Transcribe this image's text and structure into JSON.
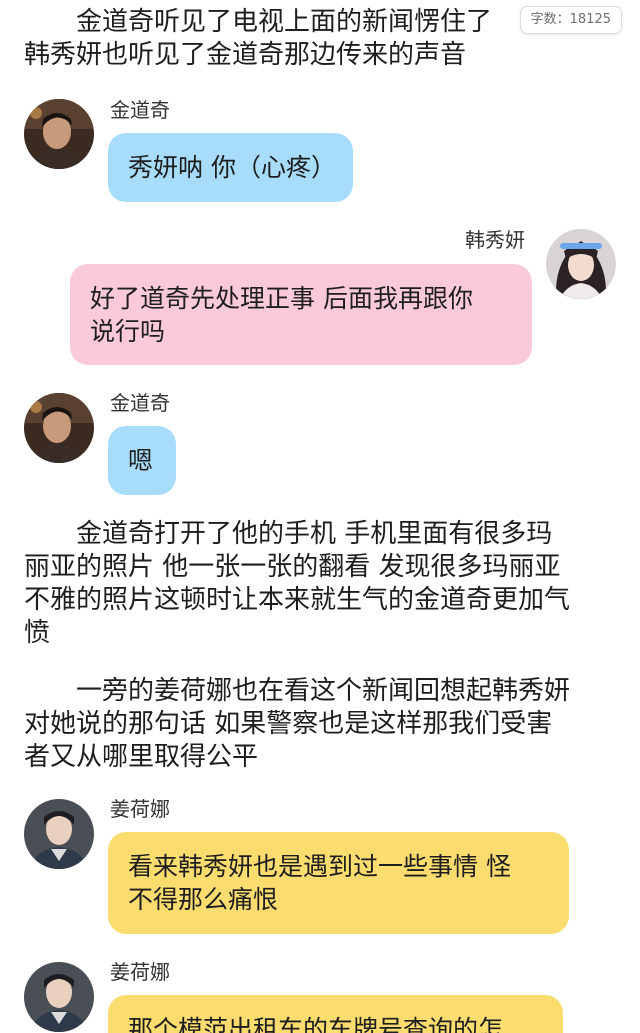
{
  "counter": {
    "label": "字数：",
    "value": "18125"
  },
  "paragraphs": {
    "p1": "　　金道奇听见了电视上面的新闻愣住了\n韩秀妍也听见了金道奇那边传来的声音",
    "p2": "　　金道奇打开了他的手机 手机里面有很多玛\n丽亚的照片 他一张一张的翻看 发现很多玛丽亚\n不雅的照片这顿时让本来就生气的金道奇更加气\n愤",
    "p3": "　　一旁的姜荷娜也在看这个新闻回想起韩秀妍\n对她说的那句话 如果警察也是这样那我们受害\n者又从哪里取得公平"
  },
  "chat": [
    {
      "sender": "金道奇",
      "text": "秀妍呐 你（心疼）"
    },
    {
      "sender": "韩秀妍",
      "text": "好了道奇先处理正事 后面我再跟你\n说行吗"
    },
    {
      "sender": "金道奇",
      "text": "嗯"
    },
    {
      "sender": "姜荷娜",
      "text": "看来韩秀妍也是遇到过一些事情 怪\n不得那么痛恨"
    },
    {
      "sender": "姜荷娜",
      "text": "那个模范出租车的车牌号查询的怎"
    }
  ],
  "colors": {
    "blue_bubble": "#a7dcfb",
    "pink_bubble": "#fbcad8",
    "yellow_bubble": "#fbdc6f"
  },
  "icons": {
    "kim": "avatar-kim-daoqi-icon",
    "han": "avatar-han-xiuyan-icon",
    "jiang": "avatar-jiang-hena-icon"
  }
}
